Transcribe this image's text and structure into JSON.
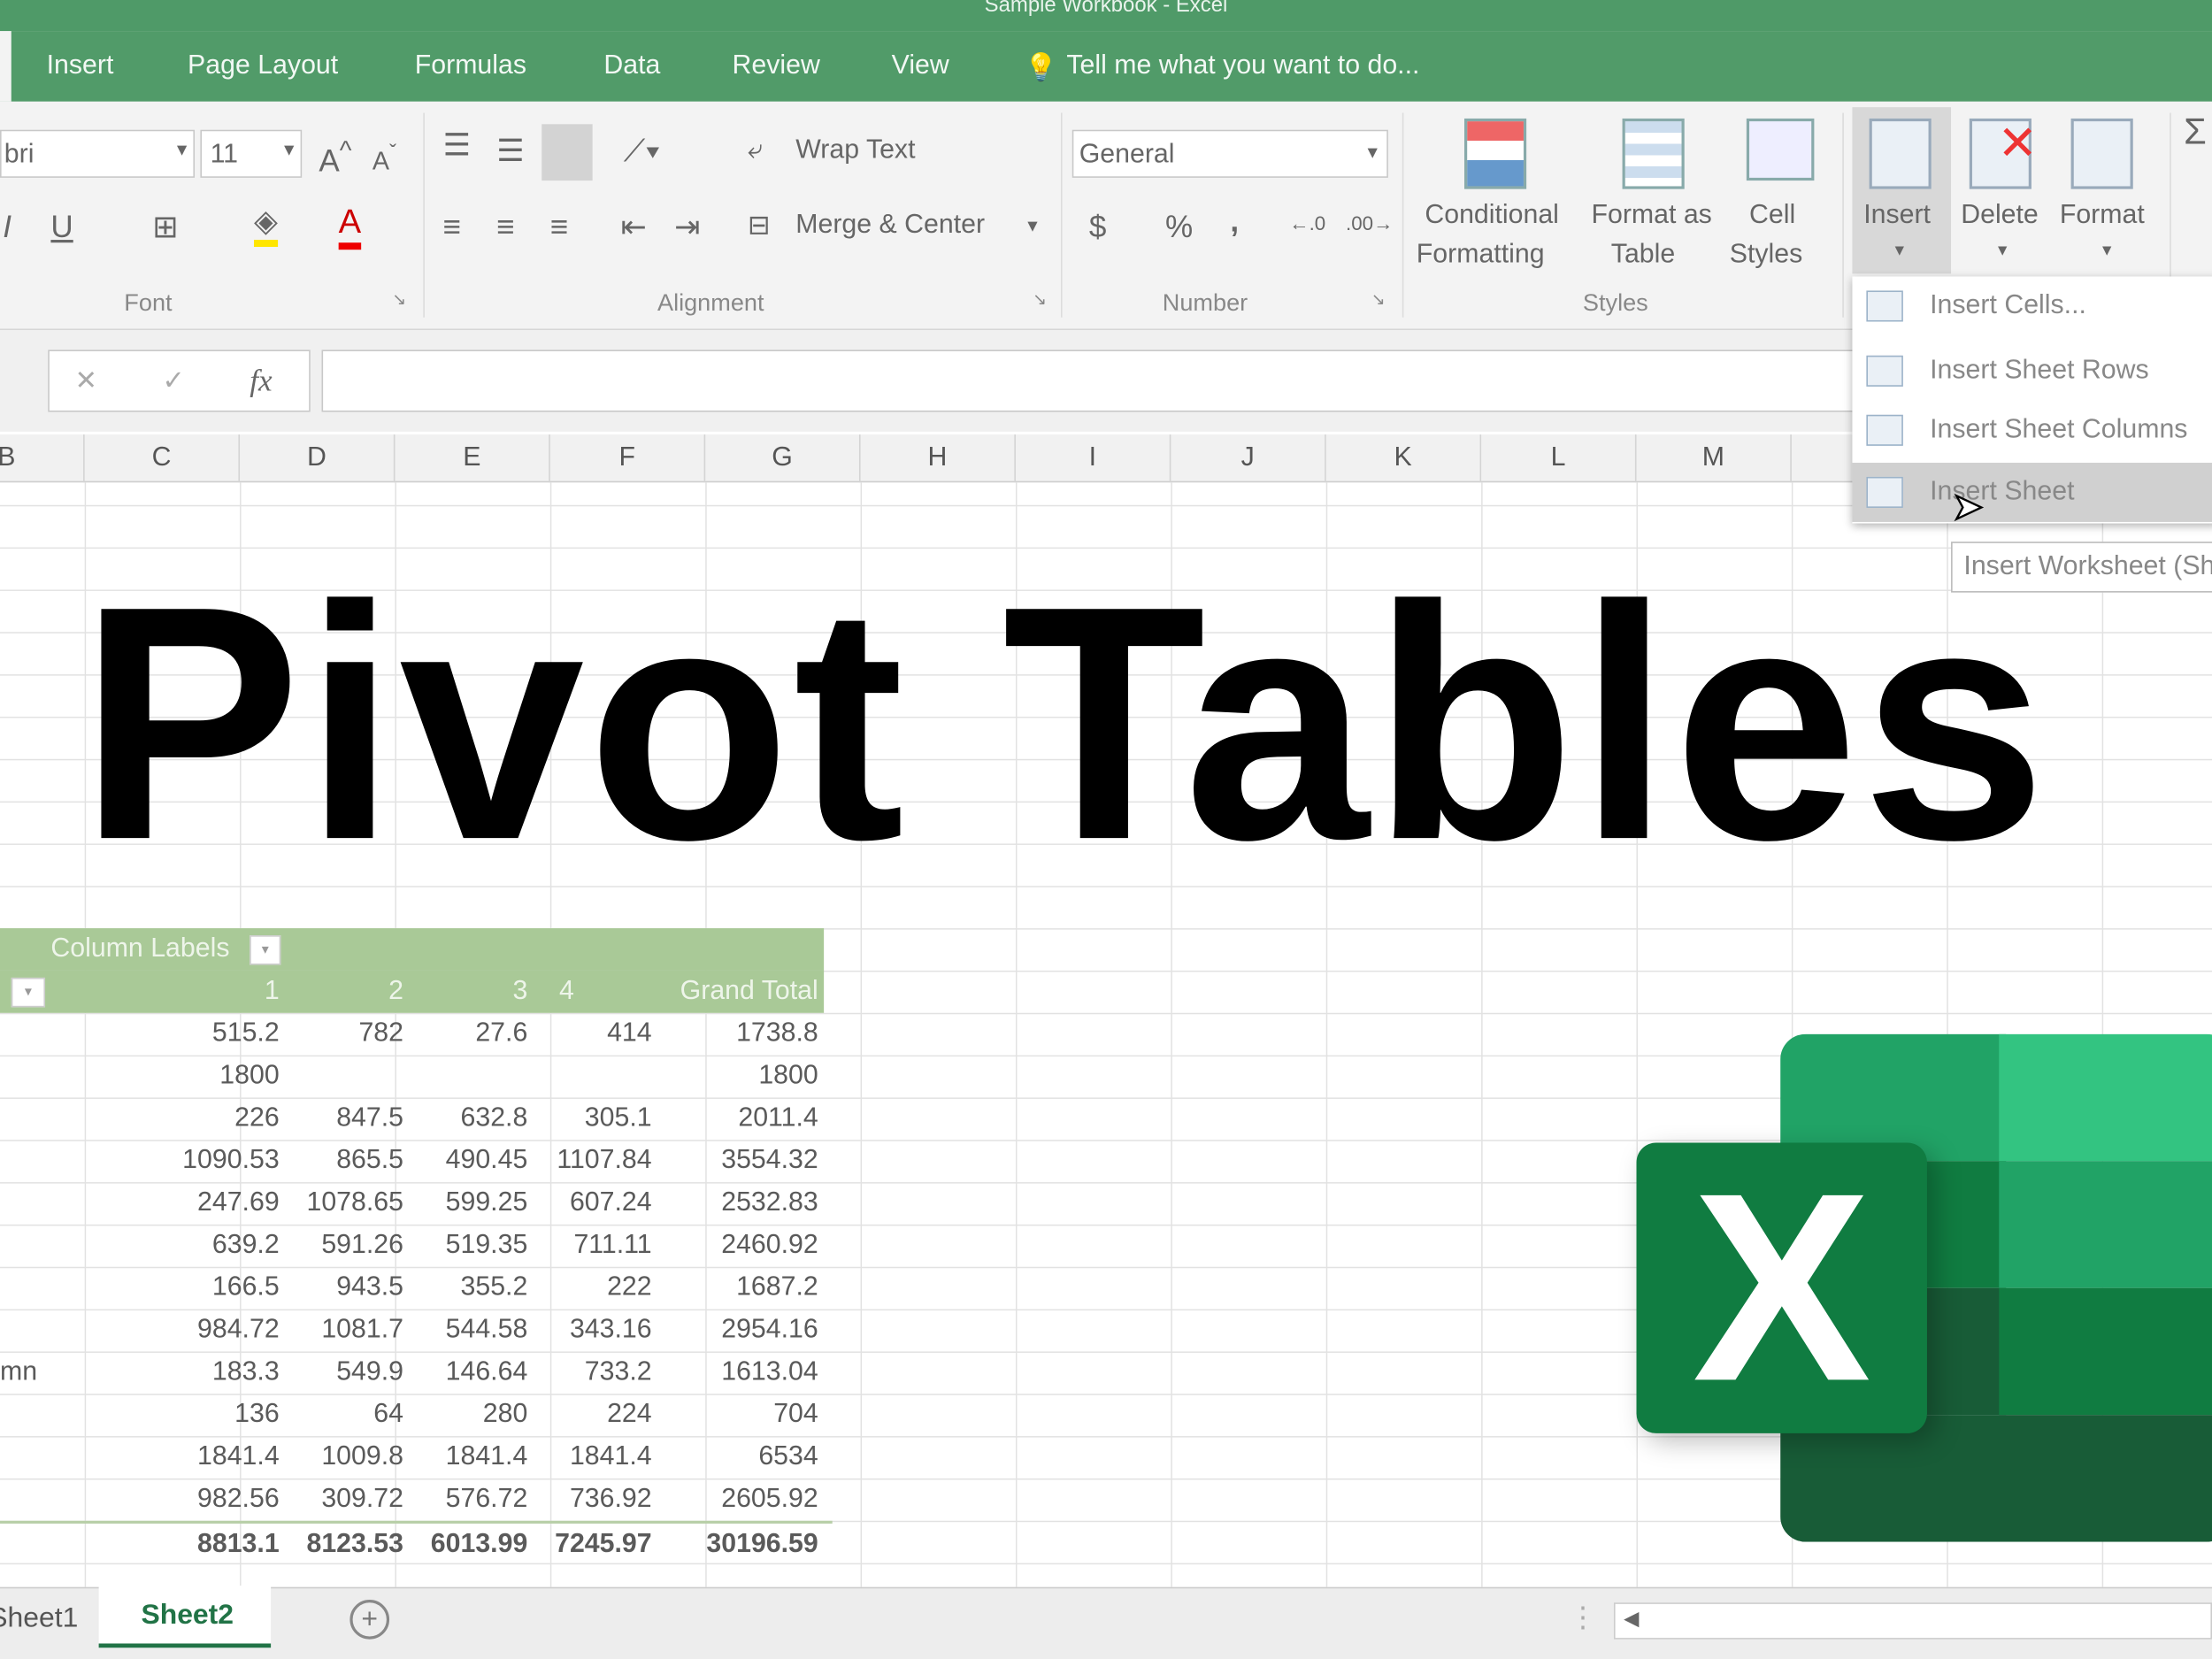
{
  "window": {
    "title": "Sample Workbook - Excel"
  },
  "ribbon_tabs": [
    "Insert",
    "Page Layout",
    "Formulas",
    "Data",
    "Review",
    "View"
  ],
  "tell_me": "Tell me what you want to do...",
  "font": {
    "name": "bri",
    "size": "11",
    "group": "Font"
  },
  "alignment": {
    "wrap": "Wrap Text",
    "merge": "Merge & Center",
    "group": "Alignment"
  },
  "number": {
    "format": "General",
    "currency": "$",
    "percent": "%",
    "comma": ",",
    "group": "Number"
  },
  "styles": {
    "conditional": [
      "Conditional",
      "Formatting"
    ],
    "format_table": [
      "Format as",
      "Table"
    ],
    "cell_styles": [
      "Cell",
      "Styles"
    ],
    "group": "Styles"
  },
  "cells": {
    "insert": "Insert",
    "delete": "Delete",
    "format": "Format"
  },
  "formula_bar": {
    "fx": "fx",
    "cancel": "✕",
    "enter": "✓",
    "value": ""
  },
  "columns": [
    "B",
    "C",
    "D",
    "E",
    "F",
    "G",
    "H",
    "I",
    "J",
    "K",
    "L",
    "M"
  ],
  "insert_menu": {
    "items": [
      "Insert Cells...",
      "Insert Sheet Rows",
      "Insert Sheet Columns",
      "Insert Sheet"
    ],
    "highlighted": "Insert Sheet",
    "tooltip": "Insert Worksheet (Sh"
  },
  "headline": "Pivot Tables",
  "pivot": {
    "column_labels": "Column Labels",
    "headers": [
      "1",
      "2",
      "3",
      "4",
      "Grand Total"
    ],
    "row_labels": [
      "",
      "",
      "",
      "",
      "",
      "",
      "",
      "",
      "mn",
      "",
      "",
      ""
    ],
    "rows": [
      [
        "515.2",
        "782",
        "27.6",
        "414",
        "1738.8"
      ],
      [
        "1800",
        "",
        "",
        "",
        "1800"
      ],
      [
        "226",
        "847.5",
        "632.8",
        "305.1",
        "2011.4"
      ],
      [
        "1090.53",
        "865.5",
        "490.45",
        "1107.84",
        "3554.32"
      ],
      [
        "247.69",
        "1078.65",
        "599.25",
        "607.24",
        "2532.83"
      ],
      [
        "639.2",
        "591.26",
        "519.35",
        "711.11",
        "2460.92"
      ],
      [
        "166.5",
        "943.5",
        "355.2",
        "222",
        "1687.2"
      ],
      [
        "984.72",
        "1081.7",
        "544.58",
        "343.16",
        "2954.16"
      ],
      [
        "183.3",
        "549.9",
        "146.64",
        "733.2",
        "1613.04"
      ],
      [
        "136",
        "64",
        "280",
        "224",
        "704"
      ],
      [
        "1841.4",
        "1009.8",
        "1841.4",
        "1841.4",
        "6534"
      ],
      [
        "982.56",
        "309.72",
        "576.72",
        "736.92",
        "2605.92"
      ]
    ],
    "totals": [
      "8813.1",
      "8123.53",
      "6013.99",
      "7245.97",
      "30196.59"
    ]
  },
  "sheets": [
    "Sheet1",
    "Sheet2"
  ],
  "active_sheet": "Sheet2",
  "colors": {
    "accent": "#519b69",
    "pivot_header": "#a9c997",
    "excel_dark": "#185c37",
    "excel_mid": "#21a366",
    "excel_light": "#33c481"
  }
}
